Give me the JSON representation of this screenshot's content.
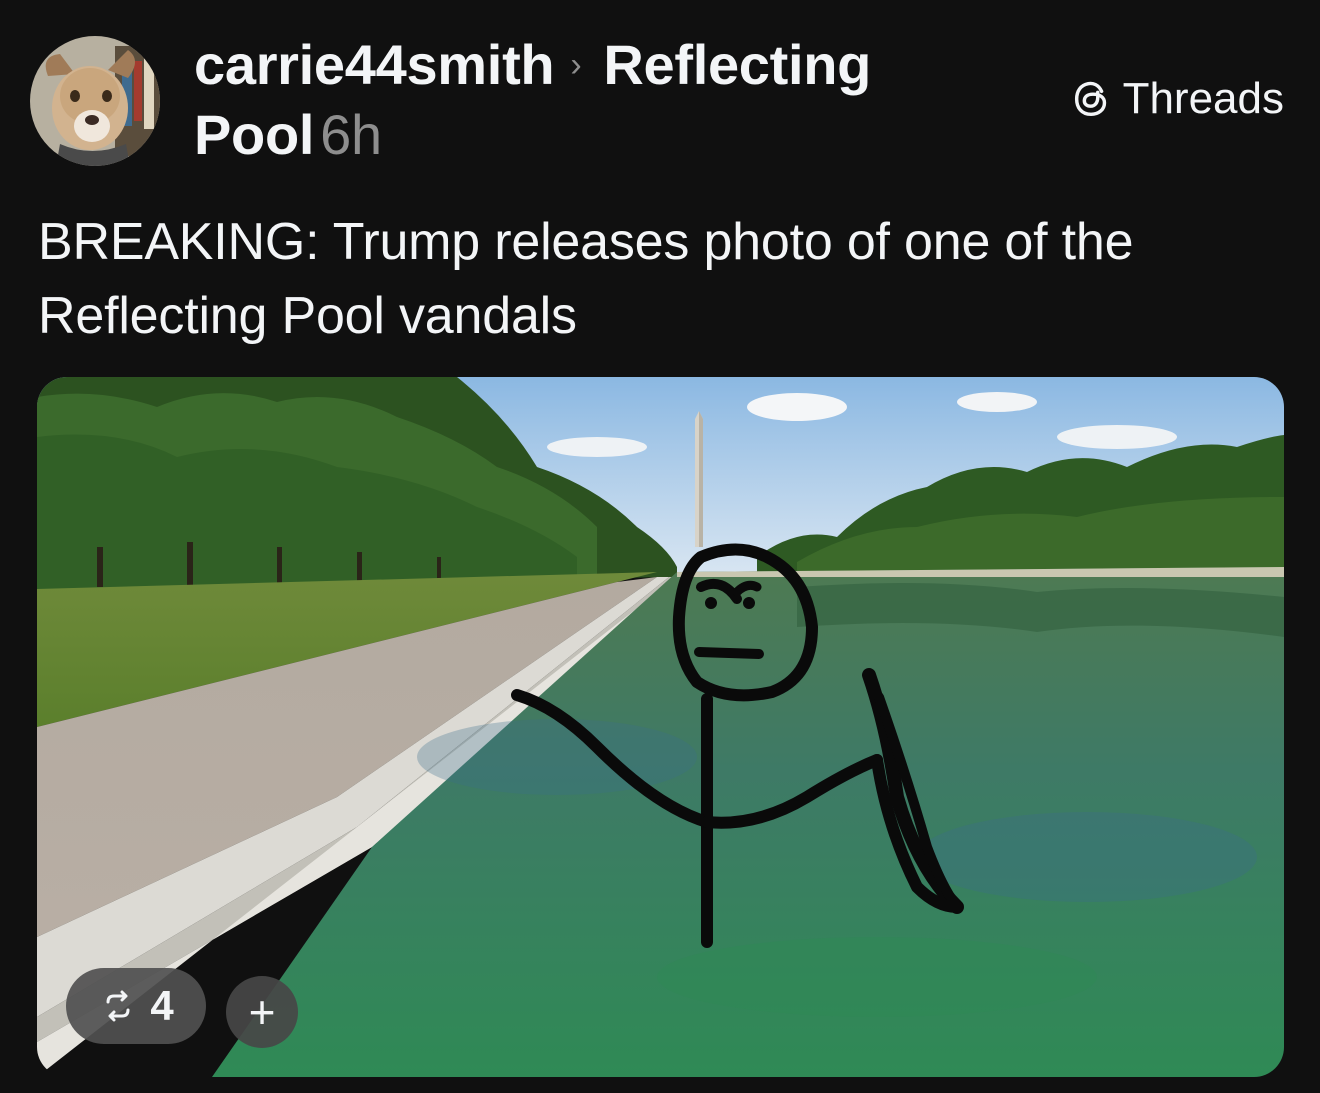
{
  "header": {
    "username": "carrie44smith",
    "chevron": "›",
    "community_line1": "Reflecting",
    "community_line2": "Pool",
    "time": "6h",
    "avatar_icon": "dog-avatar"
  },
  "brand": {
    "icon": "threads-logo-icon",
    "label": "Threads"
  },
  "post": {
    "text_line1": "BREAKING: Trump releases photo of one of the",
    "text_line2": "Reflecting Pool vandals"
  },
  "media": {
    "icon": "photo-stick-figure-reflecting-pool",
    "repost_icon": "repost-icon",
    "repost_count": "4",
    "add_label": "+"
  },
  "colors": {
    "background": "#101010",
    "text": "#f3f5f7",
    "secondary": "#8e8e8e"
  }
}
